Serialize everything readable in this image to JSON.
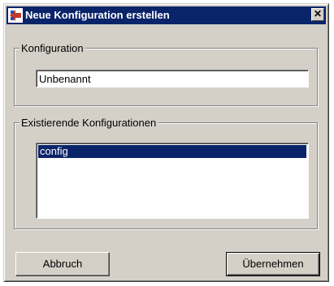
{
  "window": {
    "title": "Neue Konfiguration erstellen",
    "close_label": "✕"
  },
  "config_group": {
    "legend": "Konfiguration",
    "name_value": "Unbenannt"
  },
  "existing_group": {
    "legend": "Existierende Konfigurationen",
    "items": [
      "config"
    ]
  },
  "buttons": {
    "cancel_label": "Abbruch",
    "ok_label": "Übernehmen"
  },
  "colors": {
    "titlebar": "#0a246a",
    "face": "#d4d0c8",
    "selection": "#0a246a"
  }
}
